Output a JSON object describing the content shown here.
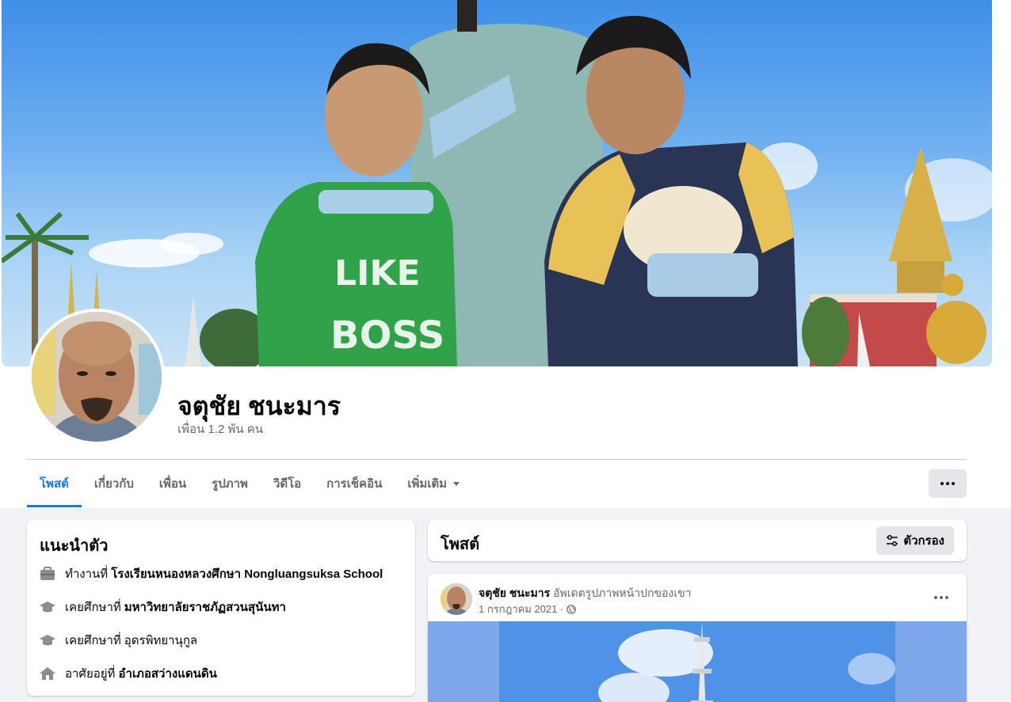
{
  "profile": {
    "name": "จตุชัย ชนะมาร",
    "friends_count": "เพื่อน 1.2 พัน คน"
  },
  "tabs": [
    {
      "label": "โพสต์",
      "active": true
    },
    {
      "label": "เกี่ยวกับ",
      "active": false
    },
    {
      "label": "เพื่อน",
      "active": false
    },
    {
      "label": "รูปภาพ",
      "active": false
    },
    {
      "label": "วิดีโอ",
      "active": false
    },
    {
      "label": "การเช็คอิน",
      "active": false
    },
    {
      "label": "เพิ่มเติม",
      "active": false
    }
  ],
  "intro": {
    "title": "แนะนำตัว",
    "work": {
      "prefix": "ทำงานที่",
      "value": "โรงเรียนหนองหลวงศึกษา Nongluangsuksa School",
      "icon": "briefcase-icon"
    },
    "education1": {
      "prefix": "เคยศึกษาที่",
      "value": "มหาวิทยาลัยราชภัฏสวนสุนันทา",
      "icon": "graduation-cap-icon"
    },
    "education2": {
      "prefix": "เคยศึกษาที่",
      "value": "อุดรพิทยานุกูล",
      "icon": "graduation-cap-icon"
    },
    "home": {
      "prefix": "อาศัยอยู่ที่",
      "value": "อำเภอสว่างแดนดิน",
      "icon": "home-icon"
    }
  },
  "posts_header": {
    "title": "โพสต์",
    "filter_label": "ตัวกรอง"
  },
  "post": {
    "author": "จตุชัย ชนะมาร",
    "action": "อัพเดตรูปภาพหน้าปกของเขา",
    "date": "1 กรกฎาคม 2021 ·"
  },
  "colors": {
    "accent": "#1877f2",
    "page_bg": "#f0f2f5",
    "secondary_text": "#65676b"
  }
}
